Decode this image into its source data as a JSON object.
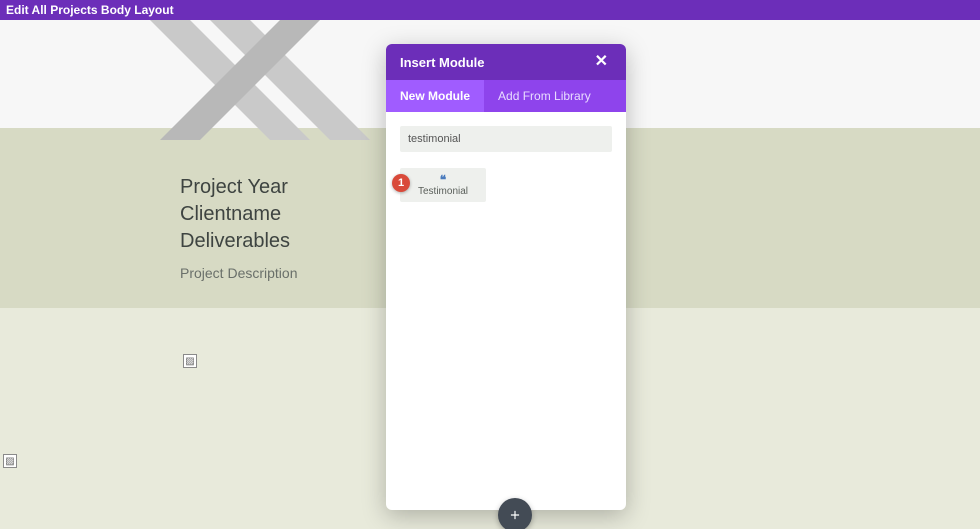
{
  "topbar": {
    "title": "Edit All Projects Body Layout"
  },
  "project": {
    "line1": "Project Year",
    "line2": "Clientname",
    "line3": "Deliverables",
    "description": "Project Description"
  },
  "modal": {
    "title": "Insert Module",
    "tabs": {
      "new": "New Module",
      "library": "Add From Library"
    },
    "search_value": "testimonial",
    "module": {
      "label": "Testimonial",
      "badge": "1"
    }
  }
}
